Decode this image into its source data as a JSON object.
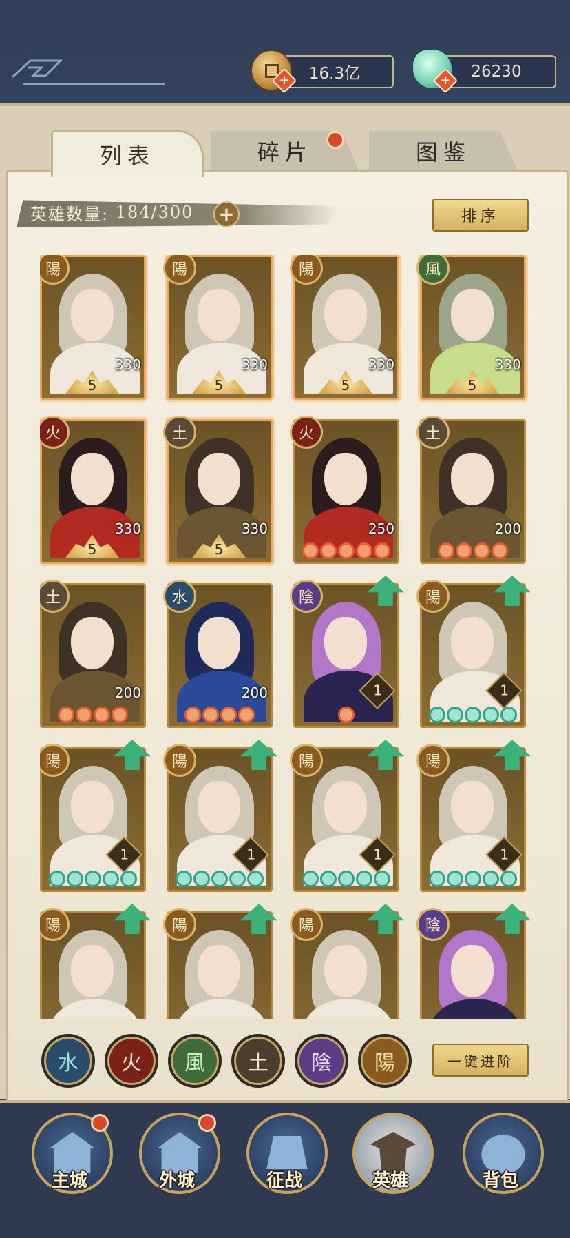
{
  "currency": {
    "gold": "16.3亿",
    "jade": "26230",
    "add_icon": "plus-icon"
  },
  "tabs": [
    {
      "label": "列表",
      "active": true
    },
    {
      "label": "碎片",
      "active": false,
      "badge": true
    },
    {
      "label": "图鉴",
      "active": false
    }
  ],
  "hero_count": {
    "label": "英雄数量:",
    "value": "184/300"
  },
  "sort_button": "排序",
  "heroes": [
    {
      "element": "陽",
      "level": "330",
      "star": "5"
    },
    {
      "element": "陽",
      "level": "330",
      "star": "5"
    },
    {
      "element": "陽",
      "level": "330",
      "star": "5"
    },
    {
      "element": "風",
      "level": "330",
      "star": "5"
    },
    {
      "element": "火",
      "level": "330",
      "star": "5"
    },
    {
      "element": "土",
      "level": "330",
      "star": "5"
    },
    {
      "element": "火",
      "level": "250",
      "orbs": 5
    },
    {
      "element": "土",
      "level": "200",
      "orbs": 4
    },
    {
      "element": "土",
      "level": "200",
      "orbs": 4
    },
    {
      "element": "水",
      "level": "200",
      "orbs": 4
    },
    {
      "element": "陰",
      "rank": "1",
      "orbs": 1,
      "upgrade": true
    },
    {
      "element": "陽",
      "rank": "1",
      "orbs": 5,
      "upgrade": true
    },
    {
      "element": "陽",
      "rank": "1",
      "orbs": 5,
      "upgrade": true
    },
    {
      "element": "陽",
      "rank": "1",
      "orbs": 5,
      "upgrade": true
    },
    {
      "element": "陽",
      "rank": "1",
      "orbs": 5,
      "upgrade": true
    },
    {
      "element": "陽",
      "rank": "1",
      "orbs": 5,
      "upgrade": true
    },
    {
      "element": "陽",
      "upgrade": true
    },
    {
      "element": "陽",
      "upgrade": true
    },
    {
      "element": "陽",
      "upgrade": true
    },
    {
      "element": "陰",
      "upgrade": true
    }
  ],
  "filters": [
    {
      "label": "水",
      "icon": "water-element-icon"
    },
    {
      "label": "火",
      "icon": "fire-element-icon"
    },
    {
      "label": "風",
      "icon": "wind-element-icon"
    },
    {
      "label": "土",
      "icon": "earth-element-icon"
    },
    {
      "label": "陰",
      "icon": "yin-element-icon"
    },
    {
      "label": "陽",
      "icon": "yang-element-icon"
    }
  ],
  "advance_button": "一键进阶",
  "nav": [
    {
      "label": "主城",
      "badge": true
    },
    {
      "label": "外城",
      "badge": true
    },
    {
      "label": "征战",
      "badge": false
    },
    {
      "label": "英雄",
      "badge": false,
      "active": true
    },
    {
      "label": "背包",
      "badge": false
    }
  ],
  "colors": {
    "frame_blue": "#2e3a52",
    "paper": "#f4efe2",
    "gold_border": "#c9a25c",
    "badge_red": "#d9482c",
    "upgrade_green": "#3bb07a"
  }
}
